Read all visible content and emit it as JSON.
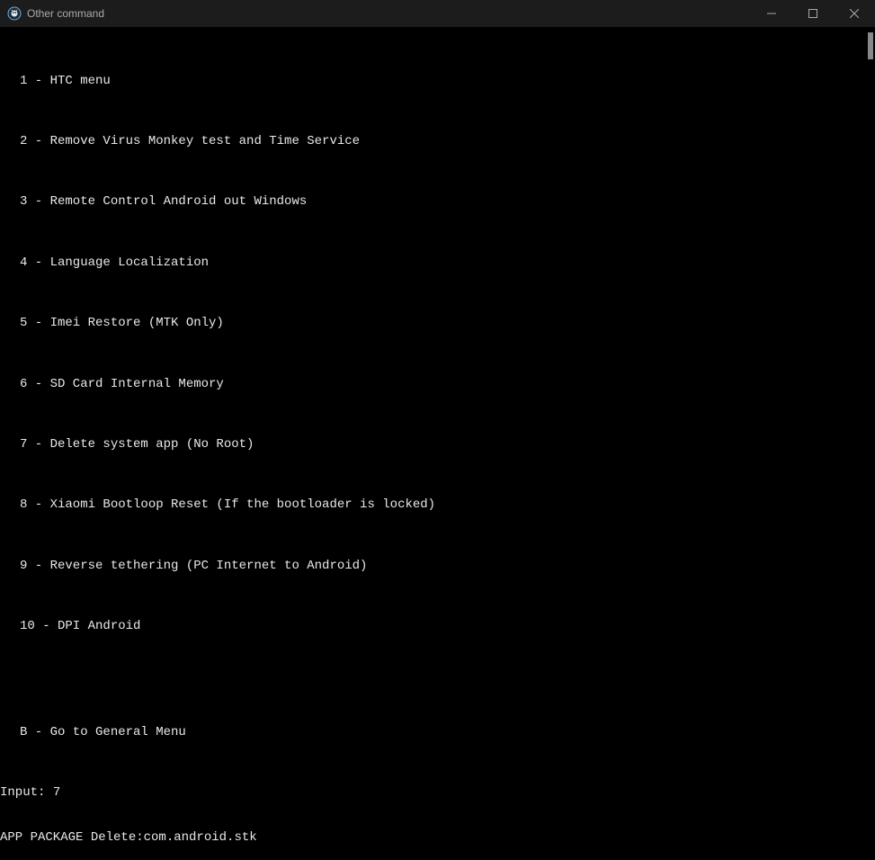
{
  "window": {
    "title": "Other command"
  },
  "menu": {
    "items": [
      "1 - HTC menu",
      "2 - Remove Virus Monkey test and Time Service",
      "3 - Remote Control Android out Windows",
      "4 - Language Localization",
      "5 - Imei Restore (MTK Only)",
      "6 - SD Card Internal Memory",
      "7 - Delete system app (No Root)",
      "8 - Xiaomi Bootloop Reset (If the bootloader is locked)",
      "9 - Reverse tethering (PC Internet to Android)",
      "10 - DPI Android"
    ],
    "back": "B - Go to General Menu"
  },
  "prompt": {
    "input_label": "Input: ",
    "input_value": "7",
    "package_line": "APP PACKAGE Delete:com.android.stk"
  }
}
